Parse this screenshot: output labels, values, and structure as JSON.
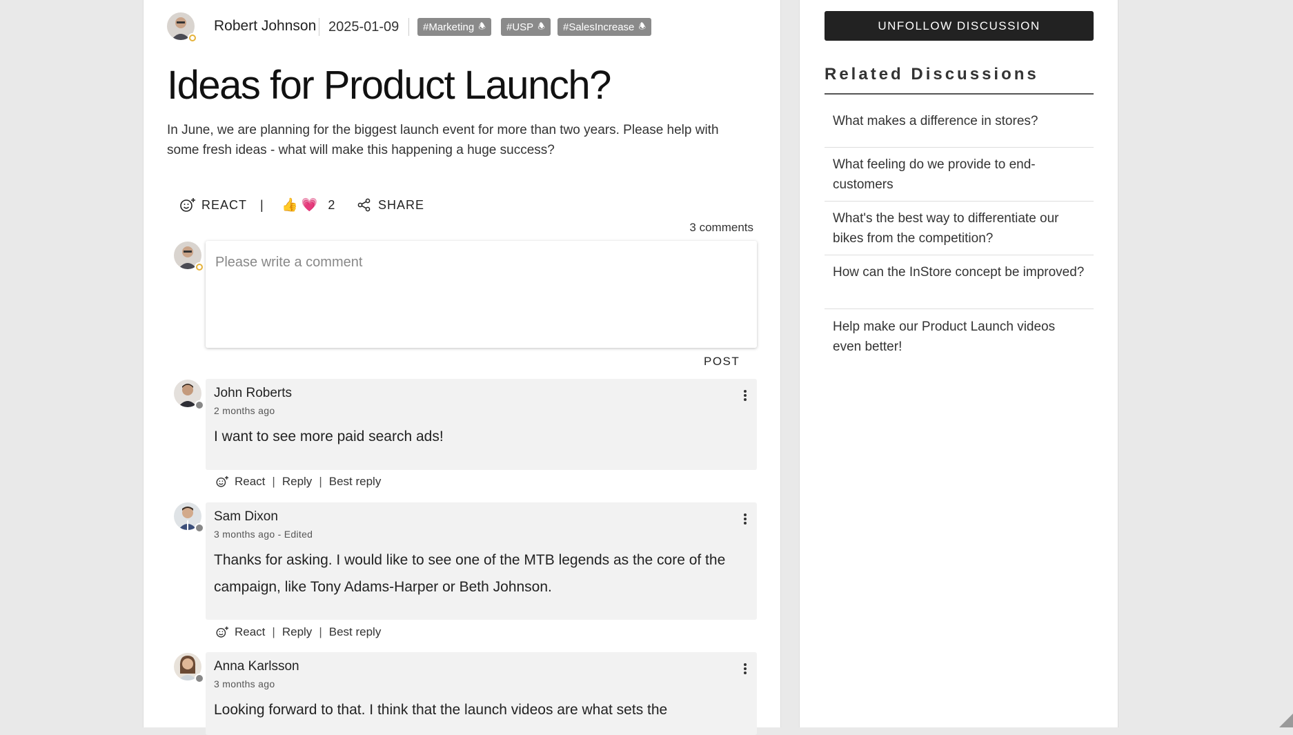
{
  "post": {
    "author": "Robert Johnson",
    "date": "2025-01-09",
    "tags": [
      "#Marketing",
      "#USP",
      "#SalesIncrease"
    ],
    "title": "Ideas for Product Launch?",
    "body": "In June, we are planning for the biggest launch event for more than two years. Please help with some fresh ideas - what will make this happening a huge success?",
    "react_label": "REACT",
    "reaction_count": "2",
    "share_label": "SHARE",
    "comments_count": "3 comments"
  },
  "comment_form": {
    "placeholder": "Please write a comment",
    "post_label": "POST"
  },
  "comments": [
    {
      "author": "John Roberts",
      "time": "2 months ago",
      "text": "I want to see more paid search ads!",
      "react": "React",
      "reply": "Reply",
      "best": "Best reply"
    },
    {
      "author": "Sam Dixon",
      "time": "3 months ago - Edited",
      "text": "Thanks for asking. I would like to see one of the MTB legends as the core of the campaign, like Tony Adams-Harper or Beth Johnson.",
      "react": "React",
      "reply": "Reply",
      "best": "Best reply"
    },
    {
      "author": "Anna Karlsson",
      "time": "3 months ago",
      "text": "Looking forward to that. I think that the launch videos are what sets the"
    }
  ],
  "sidebar": {
    "unfollow_label": "UNFOLLOW DISCUSSION",
    "related_title": "Related Discussions",
    "related": [
      "What makes a difference in stores?",
      "What feeling do we provide to end-customers",
      "What's the best way to differentiate our bikes from the competition?",
      "How can the InStore concept be improved?",
      "Help make our Product Launch videos even better!"
    ]
  },
  "icons": {
    "react": "smiley-plus-icon",
    "share": "share-icon",
    "tag": "bell-icon",
    "menu": "kebab-menu-icon",
    "reactions": [
      "thumbs-up-emoji",
      "heart-emoji"
    ]
  },
  "colors": {
    "tag_bg": "#8a8a8a",
    "button_bg": "#222222",
    "comment_bg": "#f2f2f2",
    "badge_gold": "#e5b23a"
  }
}
